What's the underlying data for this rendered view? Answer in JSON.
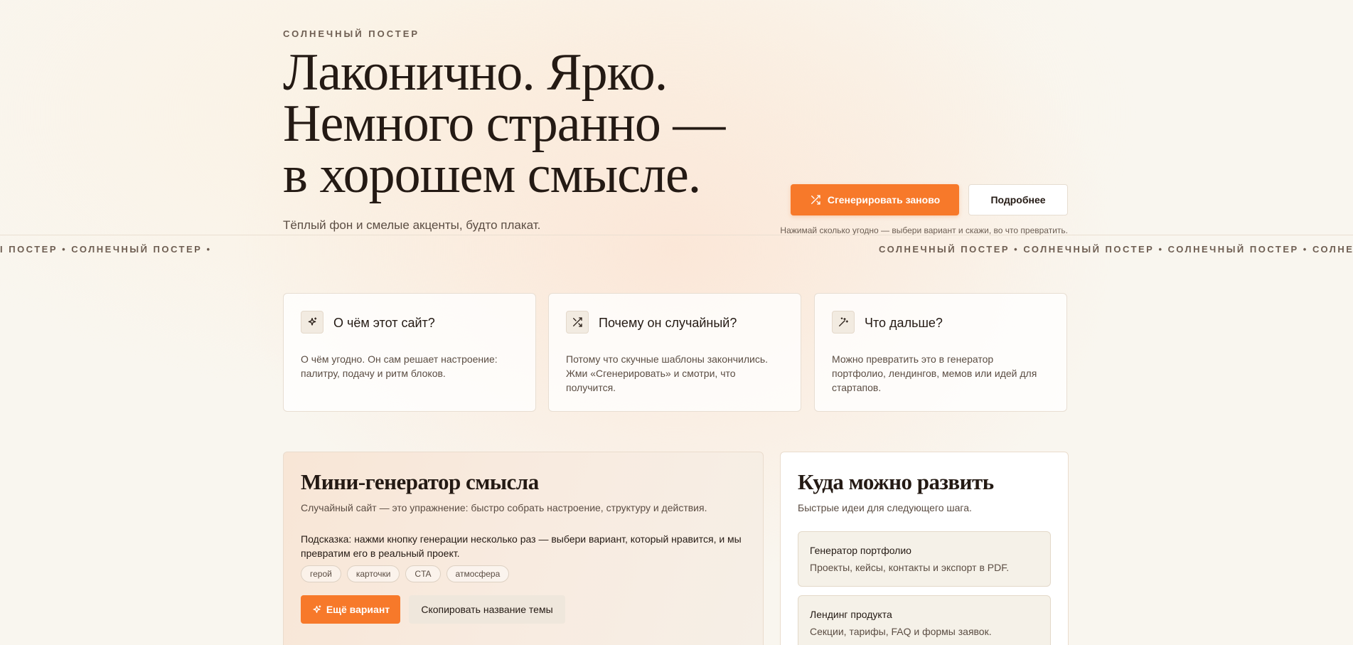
{
  "hero": {
    "eyebrow": "СОЛНЕЧНЫЙ ПОСТЕР",
    "title_lines": [
      "Лаконично. Ярко.",
      "Немного странно —",
      "в хорошем смысле."
    ],
    "subtitle": "Тёплый фон и смелые акценты, будто плакат.",
    "primary_button": "Сгенерировать заново",
    "secondary_button": "Подробнее",
    "hint": "Нажимай сколько угодно — выбери вариант и скажи, во что превратить."
  },
  "ticker": {
    "left_text": "I ПОСТЕР • СОЛНЕЧНЫЙ ПОСТЕР •",
    "right_text": "СОЛНЕЧНЫЙ ПОСТЕР • СОЛНЕЧНЫЙ ПОСТЕР • СОЛНЕЧНЫЙ ПОСТЕР • СОЛНЕЧНЫЙ"
  },
  "cards": [
    {
      "icon": "sparkle-icon",
      "title": "О чём этот сайт?",
      "text": "О чём угодно. Он сам решает настроение: палитру, подачу и ритм блоков."
    },
    {
      "icon": "shuffle-icon",
      "title": "Почему он случайный?",
      "text": "Потому что скучные шаблоны закончились. Жми «Сгенерировать» и смотри, что получится."
    },
    {
      "icon": "magic-wand-icon",
      "title": "Что дальше?",
      "text": "Можно превратить это в генератор портфолио, лендингов, мемов или идей для стартапов."
    }
  ],
  "generator": {
    "title": "Мини-генератор смысла",
    "subtitle": "Случайный сайт — это упражнение: быстро собрать настроение, структуру и действия.",
    "hint": "Подсказка: нажми кнопку генерации несколько раз — выбери вариант, который нравится, и мы превратим его в реальный проект.",
    "tags": [
      "герой",
      "карточки",
      "CTA",
      "атмосфера"
    ],
    "primary_button": "Ещё вариант",
    "secondary_button": "Скопировать название темы"
  },
  "ideas": {
    "title": "Куда можно развить",
    "subtitle": "Быстрые идеи для следующего шага.",
    "items": [
      {
        "title": "Генератор портфолио",
        "text": "Проекты, кейсы, контакты и экспорт в PDF."
      },
      {
        "title": "Лендинг продукта",
        "text": "Секции, тарифы, FAQ и формы заявок."
      }
    ]
  },
  "colors": {
    "accent": "#f7792a",
    "text": "#241a14",
    "muted": "#5b4d43",
    "background": "#f9f6ef"
  }
}
